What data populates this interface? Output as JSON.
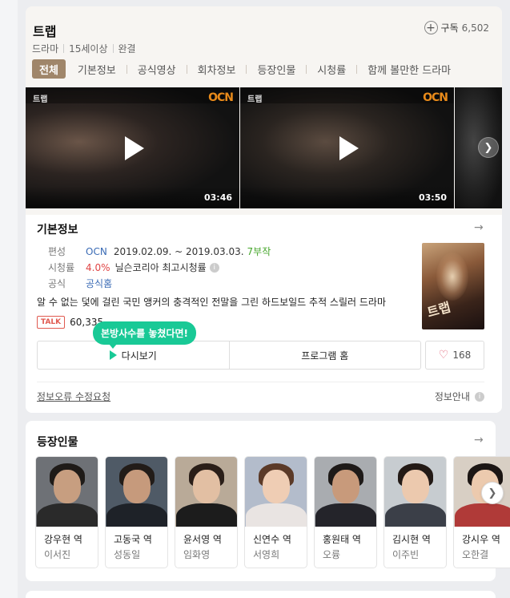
{
  "header": {
    "title": "트랩",
    "meta": [
      "드라마",
      "15세이상",
      "완결"
    ],
    "subscribe_label": "구독",
    "subscribe_count": "6,502"
  },
  "tabs": [
    "전체",
    "기본정보",
    "공식영상",
    "회차정보",
    "등장인물",
    "시청률",
    "함께 볼만한 드라마"
  ],
  "videos": [
    {
      "duration": "03:46",
      "title_overlay": "트랩",
      "logo": "OCN"
    },
    {
      "duration": "03:50",
      "title_overlay": "트랩",
      "logo": "OCN"
    }
  ],
  "basic_info": {
    "section_title": "기본정보",
    "broadcast_label": "편성",
    "channel": "OCN",
    "dates": "2019.02.09. ~ 2019.03.03.",
    "episodes": "7부작",
    "rating_label": "시청률",
    "rating_value": "4.0%",
    "rating_source": "닐슨코리아 최고시청률",
    "official_label": "공식",
    "official_link": "공식홈",
    "description": "알 수 없는 덫에 걸린 국민 앵커의 충격적인 전말을 그린 하드보일드 추적 스릴러 드라마",
    "talk_badge": "TALK",
    "talk_count": "60,335",
    "poster_title": "트랩"
  },
  "actions": {
    "tooltip": "본방사수를 놓쳤다면!",
    "replay": "다시보기",
    "program_home": "프로그램 홈",
    "likes": "168"
  },
  "footer": {
    "report": "정보오류 수정요청",
    "info": "정보안내"
  },
  "cast_section": {
    "title": "등장인물",
    "members": [
      {
        "role": "강우현 역",
        "actor": "이서진"
      },
      {
        "role": "고동국 역",
        "actor": "성동일"
      },
      {
        "role": "윤서영 역",
        "actor": "임화영"
      },
      {
        "role": "신연수 역",
        "actor": "서영희"
      },
      {
        "role": "홍원태 역",
        "actor": "오륭"
      },
      {
        "role": "김시현 역",
        "actor": "이주빈"
      },
      {
        "role": "강시우 역",
        "actor": "오한결"
      }
    ]
  },
  "colors": {
    "accent_tab": "#a0866a",
    "tooltip_green": "#19c996",
    "link_blue": "#3a6bb5",
    "episodes_green": "#45a62b",
    "rating_red": "#e04545",
    "ocn_orange": "#e88a1a"
  }
}
